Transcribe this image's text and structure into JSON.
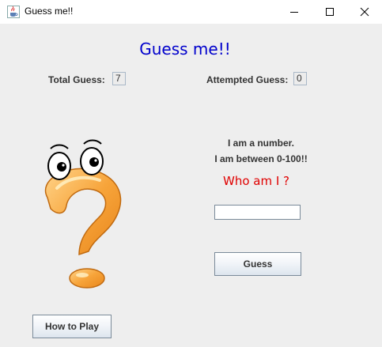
{
  "window": {
    "title": "Guess me!!",
    "icon": "java-cup-icon",
    "controls": [
      "minimize-icon",
      "maximize-icon",
      "close-icon"
    ]
  },
  "game": {
    "heading": "Guess me!!",
    "total_guess_label": "Total Guess:",
    "total_guess_value": "7",
    "attempted_guess_label": "Attempted Guess:",
    "attempted_guess_value": "0",
    "hint_line1": "I am a number.",
    "hint_line2": "I am between 0-100!!",
    "question": "Who am I ?",
    "guess_input_value": "",
    "guess_button_label": "Guess",
    "how_to_play_label": "How to Play",
    "illustration": "question-mark-with-eyes-icon"
  },
  "colors": {
    "heading": "#0000cc",
    "question": "#e00000",
    "question_mark": "#f5a033"
  }
}
